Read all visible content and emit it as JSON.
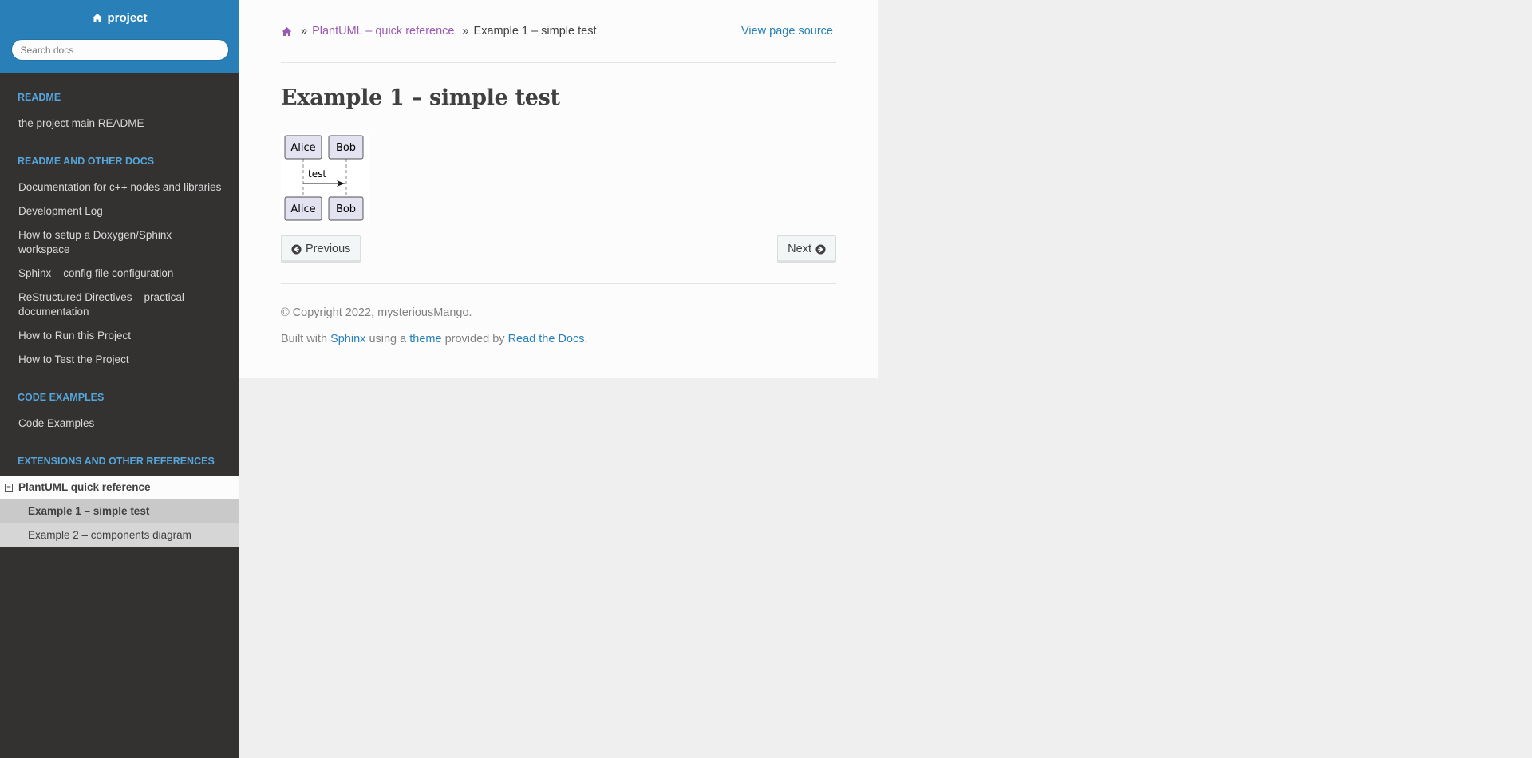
{
  "sidebar": {
    "project_name": "project",
    "search_placeholder": "Search docs",
    "sections": [
      {
        "caption": "README",
        "items": [
          "the project main README"
        ]
      },
      {
        "caption": "README AND OTHER DOCS",
        "items": [
          "Documentation for c++ nodes and libraries",
          "Development Log",
          "How to setup a Doxygen/Sphinx workspace",
          "Sphinx – config file configuration",
          "ReStructured Directives – practical documentation",
          "How to Run this Project",
          "How to Test the Project"
        ]
      },
      {
        "caption": "CODE EXAMPLES",
        "items": [
          "Code Examples"
        ]
      },
      {
        "caption": "EXTENSIONS AND OTHER REFERENCES"
      }
    ],
    "current": {
      "toggle": "−",
      "label": "PlantUML quick reference",
      "children": [
        "Example 1 – simple test",
        "Example 2 – components diagram"
      ]
    }
  },
  "breadcrumb": {
    "separator": "»",
    "parent": "PlantUML – quick reference",
    "current": "Example 1 – simple test",
    "view_source": "View page source"
  },
  "page": {
    "title": "Example 1 – simple test",
    "diagram": {
      "participants": [
        "Alice",
        "Bob"
      ],
      "message": "test"
    }
  },
  "pager": {
    "previous": "Previous",
    "next": "Next"
  },
  "footer": {
    "copyright": "© Copyright 2022, mysteriousMango.",
    "built_prefix": "Built with",
    "sphinx": "Sphinx",
    "using": "using a",
    "theme": "theme",
    "provided": "provided by",
    "rtd": "Read the Docs",
    "end": "."
  },
  "colors": {
    "sidebar_header": "#2980b9",
    "sidebar_bg": "#343131",
    "caption": "#55a5d9",
    "link": "#2980b9",
    "visited_link": "#9b59b6"
  }
}
